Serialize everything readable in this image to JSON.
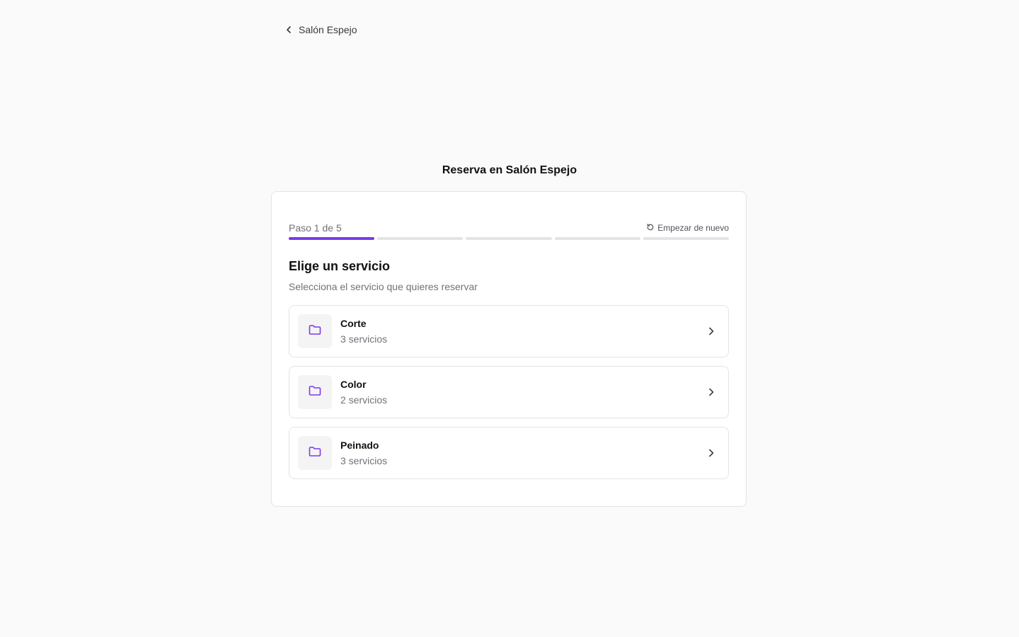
{
  "nav": {
    "back_label": "Salón Espejo"
  },
  "page": {
    "heading": "Reserva en Salón Espejo"
  },
  "wizard": {
    "step_label": "Paso 1 de 5",
    "restart_label": "Empezar de nuevo",
    "current_step": 1,
    "total_steps": 5,
    "accent_color": "#7c3aed"
  },
  "section": {
    "title": "Elige un servicio",
    "subtitle": "Selecciona el servicio que quieres reservar"
  },
  "services": [
    {
      "name": "Corte",
      "count": "3 servicios",
      "icon": "folder-icon"
    },
    {
      "name": "Color",
      "count": "2 servicios",
      "icon": "folder-icon"
    },
    {
      "name": "Peinado",
      "count": "3 servicios",
      "icon": "folder-icon"
    }
  ]
}
